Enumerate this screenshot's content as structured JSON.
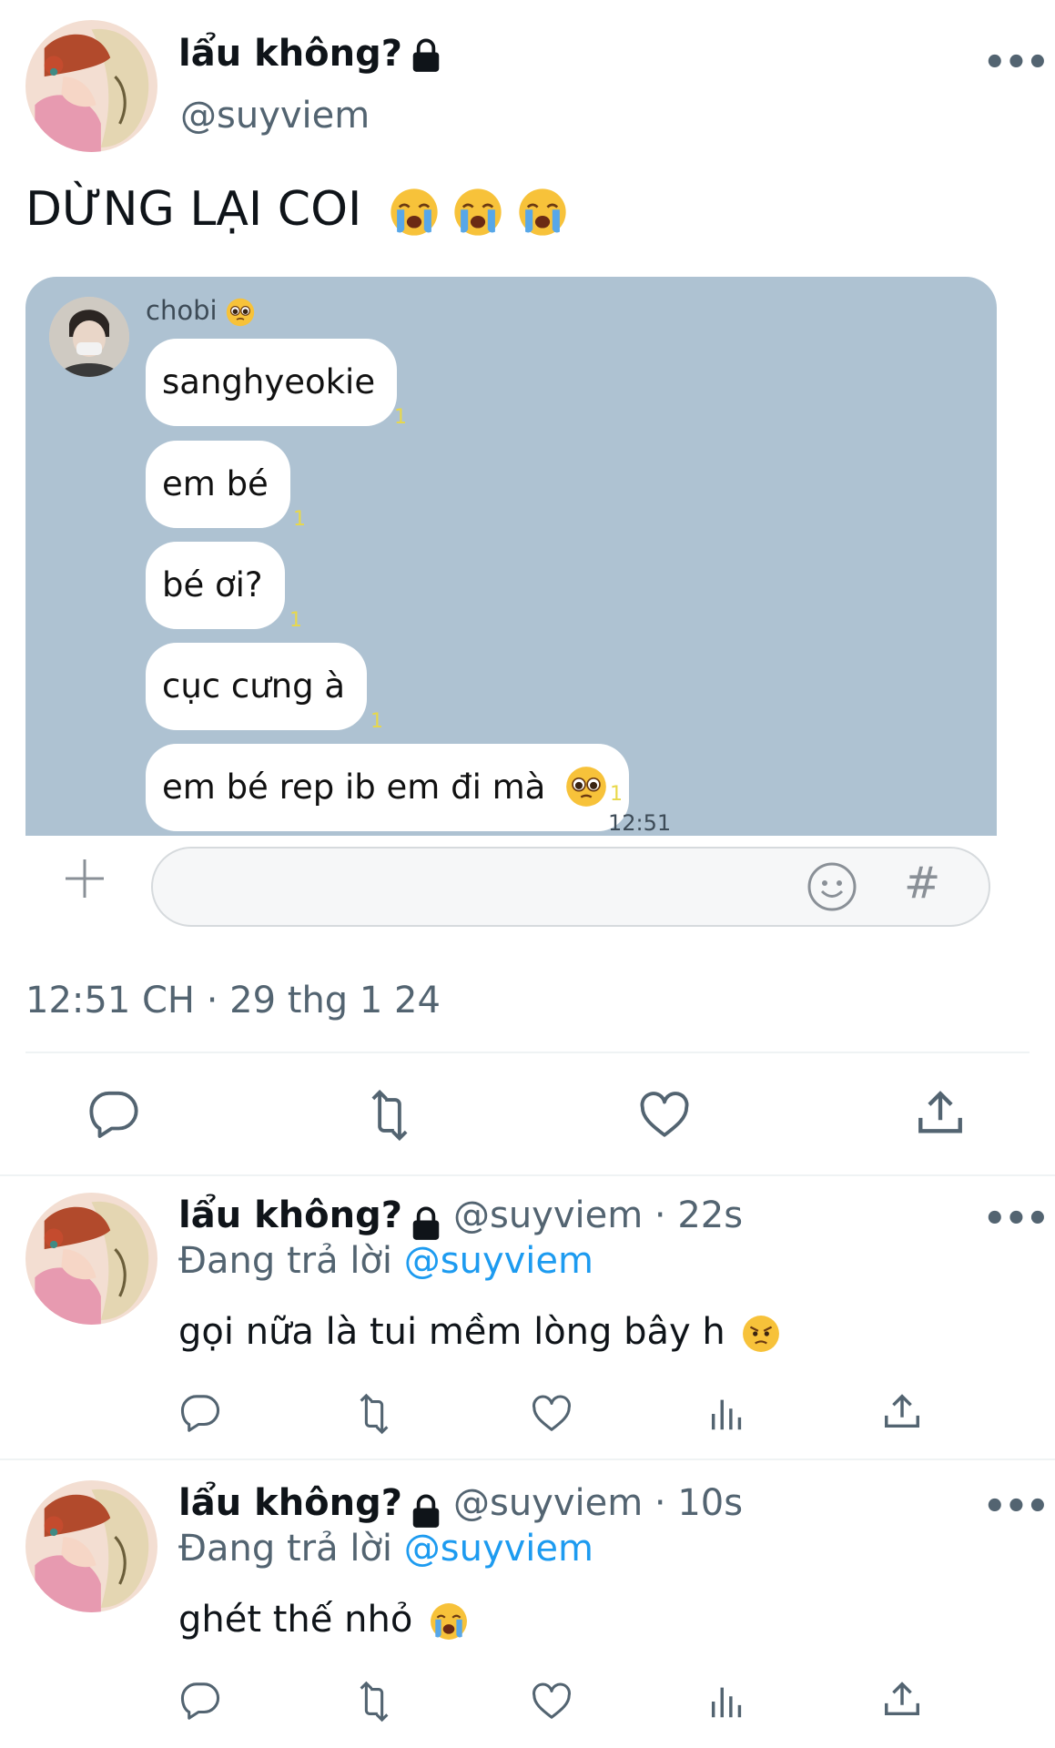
{
  "tweet": {
    "display_name": "lẩu không?",
    "handle": "@suyviem",
    "text": "DỪNG LẠI COI",
    "timestamp": "12:51 CH · 29 thg 1 24"
  },
  "chat": {
    "contact_name": "chobi",
    "messages": [
      {
        "text": "sanghyeokie",
        "read": "1"
      },
      {
        "text": "em bé",
        "read": "1"
      },
      {
        "text": "bé ơi?",
        "read": "1"
      },
      {
        "text": "cục cưng à",
        "read": "1"
      },
      {
        "text": "em bé rep ib em đi mà",
        "read": "1"
      }
    ],
    "last_time": "12:51",
    "input_placeholder": "",
    "hash_label": "#",
    "bg_color": "#aec2d2"
  },
  "replies": [
    {
      "display_name": "lẩu không?",
      "meta": "@suyviem · 22s",
      "replying_prefix": "Đang trả lời",
      "replying_to": "@suyviem",
      "text": "gọi nữa là tui mềm lòng bây h"
    },
    {
      "display_name": "lẩu không?",
      "meta": "@suyviem · 10s",
      "replying_prefix": "Đang trả lời",
      "replying_to": "@suyviem",
      "text": "ghét thế nhỏ"
    }
  ],
  "colors": {
    "link": "#1d9bf0",
    "muted": "#536471",
    "icon": "#536471"
  }
}
